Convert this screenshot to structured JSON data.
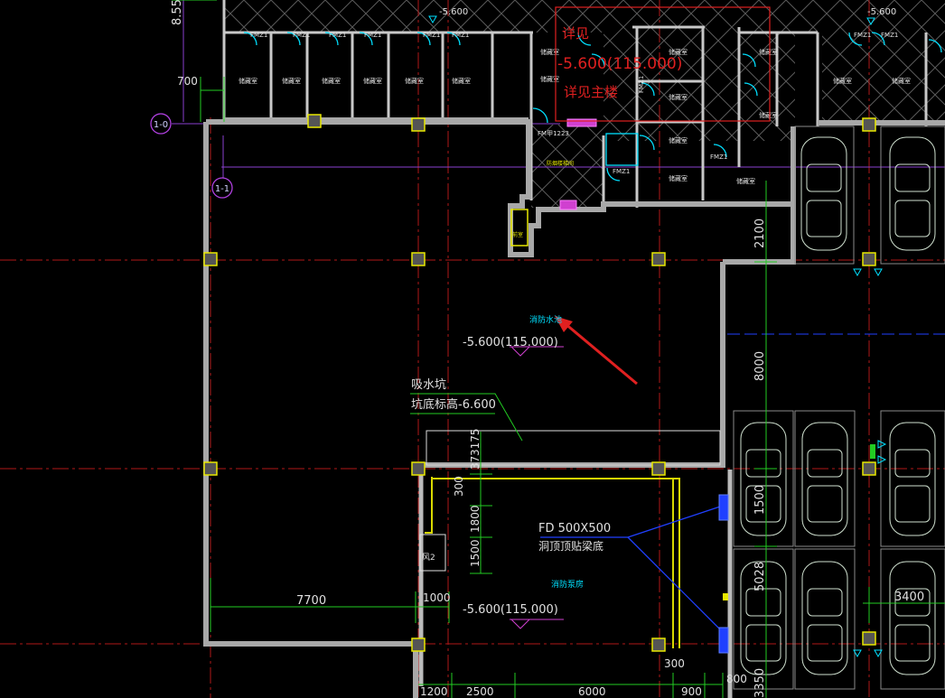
{
  "axes": {
    "bubble_10": "1-0",
    "bubble_11": "1-1"
  },
  "dims": {
    "top_cut": "8.55",
    "d700": "700",
    "d2100": "2100",
    "d8000": "8000",
    "d1500_v": "1500",
    "d5028": "5028",
    "d3400": "3400",
    "d7700": "7700",
    "d1000": "1000",
    "d1200": "1200",
    "d2500": "2500",
    "d6000": "6000",
    "d900": "900",
    "d800": "800",
    "d3350": "3350",
    "d300_b": "300",
    "d300_l": "300",
    "d3175": "3175",
    "d37": "37",
    "d1800": "1800",
    "d1500_l": "1500"
  },
  "labels": {
    "elev_top_left": "-5.600",
    "elev_top_right": "-5.600",
    "elev_main": "-5.600(115.000)",
    "elev_pump": "-5.600(115.000)",
    "red_overlay_1": "详见",
    "red_overlay_2": "-5.600(115.000)",
    "red_overlay_3": "详见主楼",
    "pit_1": "吸水坑",
    "pit_2": "坑底标高-6.600",
    "fd_1": "FD 500X500",
    "fd_2": "洞顶顶贴梁底",
    "pool_label": "消防水池",
    "pump_label": "消防泵房",
    "fm_door": "FM甲1223",
    "shaft_tag": "风2"
  },
  "colors": {
    "wall": "#c8c8c8",
    "axis": "#b01818",
    "dim": "#22cc22",
    "cyan": "#00e0ff",
    "annot_red": "#e02020",
    "magenta": "#d040d0",
    "purple": "#8a40d0",
    "yellow": "#e8e800",
    "blue": "#2040ff"
  }
}
